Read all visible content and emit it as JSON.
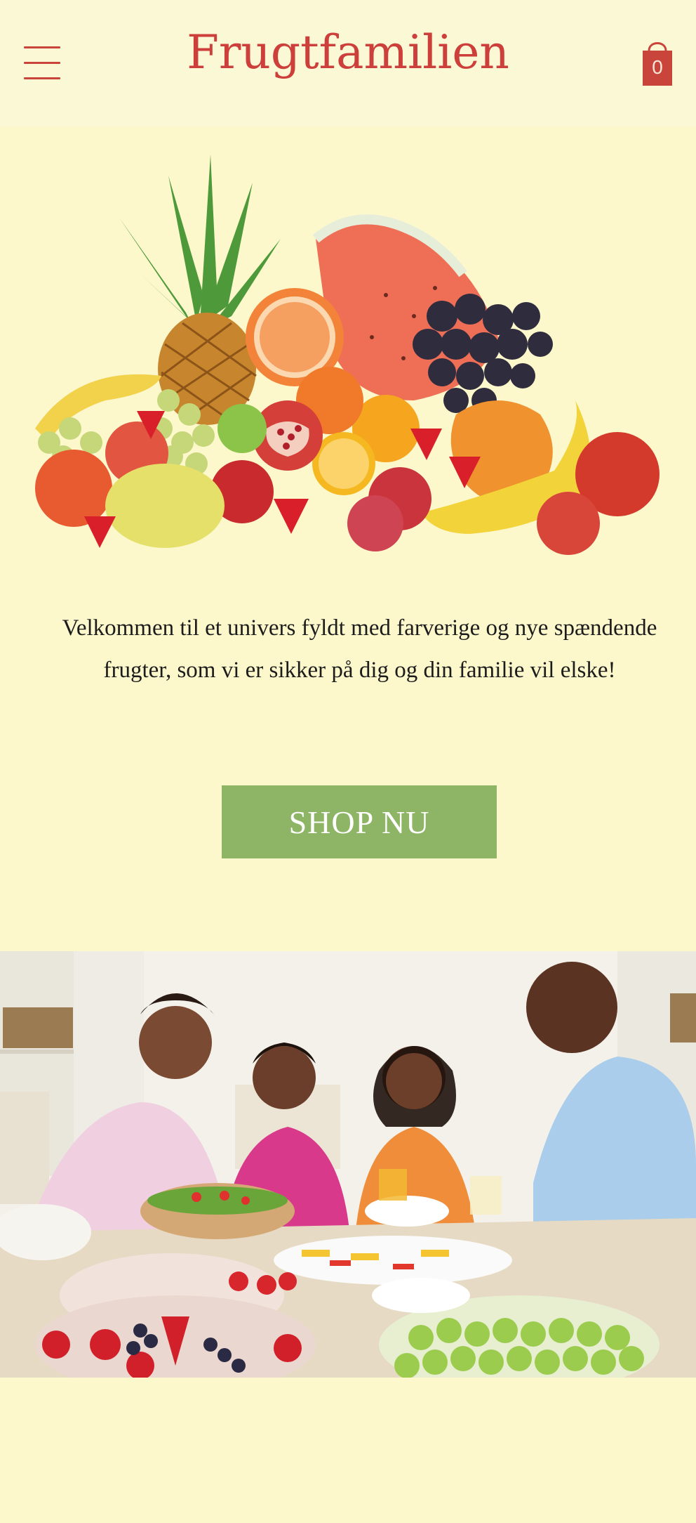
{
  "header": {
    "brand": "Frugtfamilien",
    "cart_count": "0",
    "menu_icon": "hamburger-menu-icon",
    "cart_icon": "shopping-bag-icon"
  },
  "hero": {
    "image_subject": "assorted-fruits"
  },
  "intro": {
    "text": "Velkommen til et univers fyldt med farverige og nye spændende frugter, som vi er sikker på dig og din familie vil elske!"
  },
  "cta": {
    "label": "SHOP NU"
  },
  "family": {
    "image_subject": "family-dinner-table"
  },
  "colors": {
    "background": "#fcf8cc",
    "brand_red": "#cc3f3a",
    "button_green": "#8db565"
  }
}
